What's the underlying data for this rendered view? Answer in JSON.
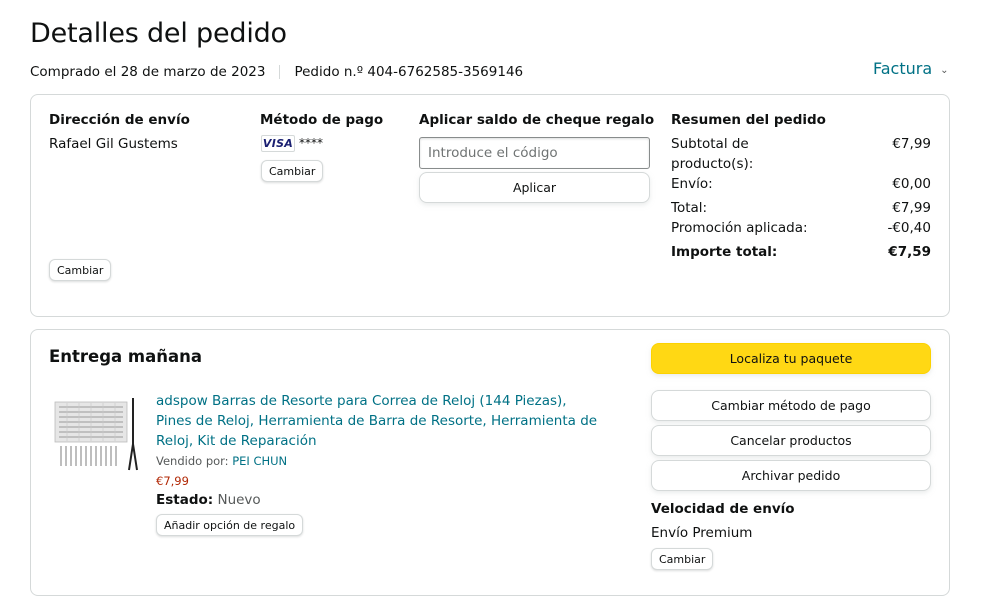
{
  "page": {
    "title": "Detalles del pedido",
    "purchased": "Comprado el 28 de marzo de 2023",
    "order_number": "Pedido n.º 404-6762585-3569146",
    "invoice_label": "Factura"
  },
  "summary_card": {
    "shipping": {
      "heading": "Dirección de envío",
      "name": "Rafael Gil Gustems",
      "change_label": "Cambiar"
    },
    "payment": {
      "heading": "Método de pago",
      "card_brand": "VISA",
      "card_digits": "****",
      "change_label": "Cambiar"
    },
    "gift_card": {
      "heading": "Aplicar saldo de cheque regalo",
      "placeholder": "Introduce el código",
      "apply_label": "Aplicar"
    },
    "order_summary": {
      "heading": "Resumen del pedido",
      "subtotal_label_line1": "Subtotal de",
      "subtotal_label_line2": "producto(s):",
      "subtotal_value": "€7,99",
      "shipping_label": "Envío:",
      "shipping_value": "€0,00",
      "total_label": "Total:",
      "total_value": "€7,99",
      "promo_label": "Promoción aplicada:",
      "promo_value": "-€0,40",
      "grand_total_label": "Importe total:",
      "grand_total_value": "€7,59"
    }
  },
  "delivery_card": {
    "heading": "Entrega mañana",
    "product": {
      "title": "adspow Barras de Resorte para Correa de Reloj (144 Piezas), Pines de Reloj, Herramienta de Barra de Resorte, Herramienta de Reloj, Kit de Reparación",
      "sold_by_label": "Vendido por:",
      "seller": "PEI CHUN",
      "price": "€7,99",
      "condition_label": "Estado:",
      "condition_value": "Nuevo",
      "gift_option_label": "Añadir opción de regalo"
    },
    "actions": {
      "track": "Localiza tu paquete",
      "change_payment": "Cambiar método de pago",
      "cancel": "Cancelar productos",
      "archive": "Archivar pedido"
    },
    "shipping_speed": {
      "heading": "Velocidad de envío",
      "value": "Envío Premium",
      "change_label": "Cambiar"
    }
  },
  "colors": {
    "link": "#007185",
    "yellow_button": "#ffd814",
    "price": "#b12704",
    "border": "#d5d9d9"
  }
}
